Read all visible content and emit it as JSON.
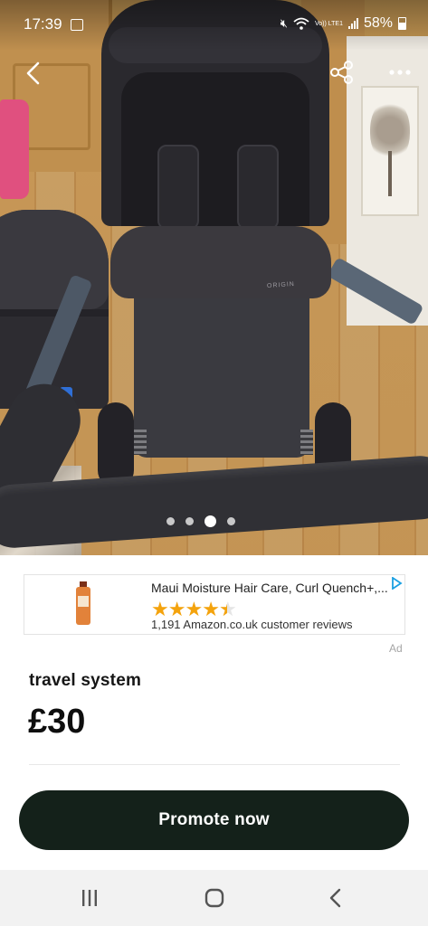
{
  "status_bar": {
    "time": "17:39",
    "network": "Vo)) LTE1",
    "battery": "58%"
  },
  "photo": {
    "footmuff_label": "ORIGIN",
    "carousel": {
      "count": 4,
      "active_index": 2
    }
  },
  "ad": {
    "title": "Maui Moisture Hair Care, Curl Quench+,...",
    "rating": 4.5,
    "reviews": "1,191 Amazon.co.uk customer reviews",
    "tag": "Ad"
  },
  "listing": {
    "title": "travel system",
    "price": "£30"
  },
  "actions": {
    "promote_label": "Promote now"
  },
  "colors": {
    "promote_bg": "#14211a",
    "star": "#f4a30d",
    "ad_choices": "#1ba0e2"
  }
}
